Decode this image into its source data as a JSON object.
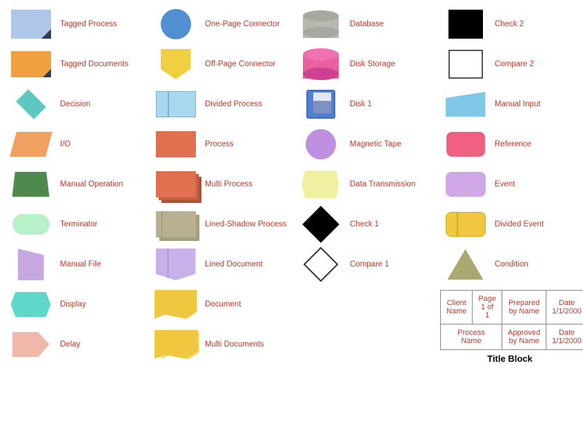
{
  "items": [
    {
      "id": "tagged-process",
      "label": "Tagged Process",
      "col": 1
    },
    {
      "id": "tagged-documents",
      "label": "Tagged Documents",
      "col": 1
    },
    {
      "id": "decision",
      "label": "Decision",
      "col": 1
    },
    {
      "id": "io",
      "label": "I/O",
      "col": 1
    },
    {
      "id": "manual-operation",
      "label": "Manual Operation",
      "col": 1
    },
    {
      "id": "terminator",
      "label": "Terminator",
      "col": 1
    },
    {
      "id": "manual-file",
      "label": "Manual File",
      "col": 1
    },
    {
      "id": "display",
      "label": "Display",
      "col": 1
    },
    {
      "id": "delay",
      "label": "Delay",
      "col": 1
    },
    {
      "id": "one-page-connector",
      "label": "One-Page Connector",
      "col": 2
    },
    {
      "id": "off-page-connector",
      "label": "Off-Page Connector",
      "col": 2
    },
    {
      "id": "divided-process",
      "label": "Divided Process",
      "col": 2
    },
    {
      "id": "process",
      "label": "Process",
      "col": 2
    },
    {
      "id": "multi-process",
      "label": "Multi Process",
      "col": 2
    },
    {
      "id": "lined-shadow-process",
      "label": "Lined-Shadow Process",
      "col": 2
    },
    {
      "id": "lined-document",
      "label": "Lined Document",
      "col": 2
    },
    {
      "id": "document",
      "label": "Document",
      "col": 2
    },
    {
      "id": "multi-documents",
      "label": "Multi Documents",
      "col": 2
    },
    {
      "id": "database",
      "label": "Database",
      "col": 3
    },
    {
      "id": "disk-storage",
      "label": "Disk Storage",
      "col": 3
    },
    {
      "id": "disk1",
      "label": "Disk 1",
      "col": 3
    },
    {
      "id": "magnetic-tape",
      "label": "Magnetic Tape",
      "col": 3
    },
    {
      "id": "data-transmission",
      "label": "Data Transmission",
      "col": 3
    },
    {
      "id": "check1",
      "label": "Check 1",
      "col": 3
    },
    {
      "id": "compare1",
      "label": "Compare 1",
      "col": 3
    },
    {
      "id": "check2",
      "label": "Check 2",
      "col": 4
    },
    {
      "id": "compare2",
      "label": "Compare 2",
      "col": 4
    },
    {
      "id": "manual-input",
      "label": "Manual Input",
      "col": 4
    },
    {
      "id": "reference",
      "label": "Reference",
      "col": 4
    },
    {
      "id": "event",
      "label": "Event",
      "col": 4
    },
    {
      "id": "divided-event",
      "label": "Divided Event",
      "col": 4
    },
    {
      "id": "condition",
      "label": "Condition",
      "col": 4
    }
  ],
  "title_block": {
    "rows": [
      [
        "Client Name",
        "Page 1 of 1",
        "Prepared by Name",
        "Date 1/1/2000"
      ],
      [
        "Process Name",
        "",
        "Approved by Name",
        "Date 1/1/2000"
      ]
    ],
    "label": "Title Block"
  }
}
